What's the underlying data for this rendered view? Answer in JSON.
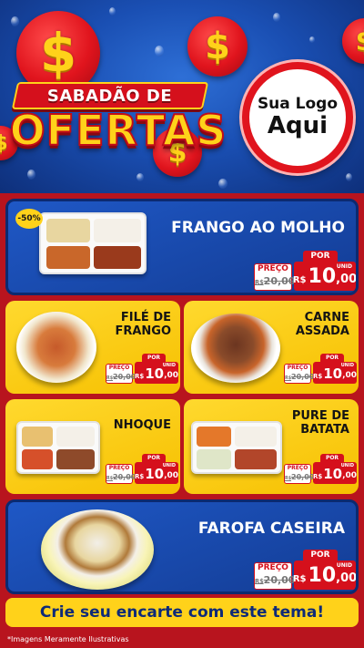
{
  "header": {
    "title_top": "SABADÃO DE",
    "title_main": "OFERTAS",
    "logo_line1": "Sua Logo",
    "logo_line2": "Aqui",
    "coin_symbol": "$"
  },
  "colors": {
    "brand_red": "#d5101c",
    "brand_yellow": "#ffd21a",
    "brand_blue": "#1a4fb3"
  },
  "products": [
    {
      "name_line1": "FRANGO AO MOLHO",
      "name_line2": "",
      "badge": "-50%",
      "por": "POR",
      "preco_label": "PREÇO",
      "old_currency": "R$",
      "old_price": "20,00",
      "currency": "R$",
      "price_int": "10",
      "price_dec": ",00",
      "unit": "UNID"
    },
    {
      "name_line1": "FILÉ DE",
      "name_line2": "FRANGO",
      "por": "POR",
      "preco_label": "PREÇO",
      "old_currency": "R$",
      "old_price": "20,00",
      "currency": "R$",
      "price_int": "10",
      "price_dec": ",00",
      "unit": "UNID"
    },
    {
      "name_line1": "CARNE",
      "name_line2": "ASSADA",
      "por": "POR",
      "preco_label": "PREÇO",
      "old_currency": "R$",
      "old_price": "20,00",
      "currency": "R$",
      "price_int": "10",
      "price_dec": ",00",
      "unit": "UNID"
    },
    {
      "name_line1": "NHOQUE",
      "name_line2": "",
      "por": "POR",
      "preco_label": "PREÇO",
      "old_currency": "R$",
      "old_price": "20,00",
      "currency": "R$",
      "price_int": "10",
      "price_dec": ",00",
      "unit": "UNID"
    },
    {
      "name_line1": "PURE DE",
      "name_line2": "BATATA",
      "por": "POR",
      "preco_label": "PREÇO",
      "old_currency": "R$",
      "old_price": "20,00",
      "currency": "R$",
      "price_int": "10",
      "price_dec": ",00",
      "unit": "UNID"
    },
    {
      "name_line1": "FAROFA CASEIRA",
      "name_line2": "",
      "por": "POR",
      "preco_label": "PREÇO",
      "old_currency": "R$",
      "old_price": "20,00",
      "currency": "R$",
      "price_int": "10",
      "price_dec": ",00",
      "unit": "UNID"
    }
  ],
  "footer": {
    "cta": "Crie seu encarte com este tema!",
    "disclaimer": "*Imagens Meramente Ilustrativas"
  }
}
